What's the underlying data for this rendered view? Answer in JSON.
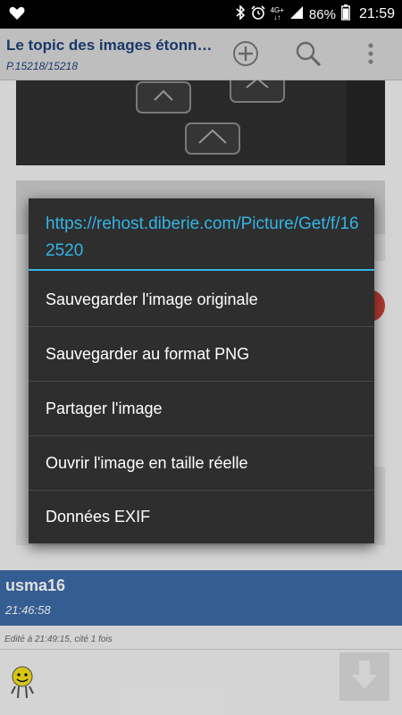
{
  "status_bar": {
    "network_line1": "4G+",
    "network_line2": "↓↑",
    "battery": "86%",
    "time": "21:59"
  },
  "action_bar": {
    "title": "Le topic des images étonn…",
    "page": "P.15218/15218"
  },
  "post": {
    "username": "usma16",
    "time": "21:46:58",
    "edit_info": "Edité à 21:49:15, cité 1 fois"
  },
  "dialog": {
    "title": "https://rehost.diberie.com/Picture/Get/f/162520",
    "items": [
      "Sauvegarder l'image originale",
      "Sauvegarder au format PNG",
      "Partager l'image",
      "Ouvrir l'image en taille réelle",
      "Données EXIF"
    ]
  },
  "colors": {
    "accent": "#33b5e5",
    "dialog_bg": "#2e2e2e",
    "title_blue": "#1d3f78",
    "user_bar": "#3c6aa7"
  },
  "icons": [
    "heart-icon",
    "bluetooth-icon",
    "alarm-icon",
    "signal-icon",
    "battery-icon",
    "add-icon",
    "search-icon",
    "overflow-menu-icon",
    "smiley-icon",
    "arrow-down-icon"
  ]
}
